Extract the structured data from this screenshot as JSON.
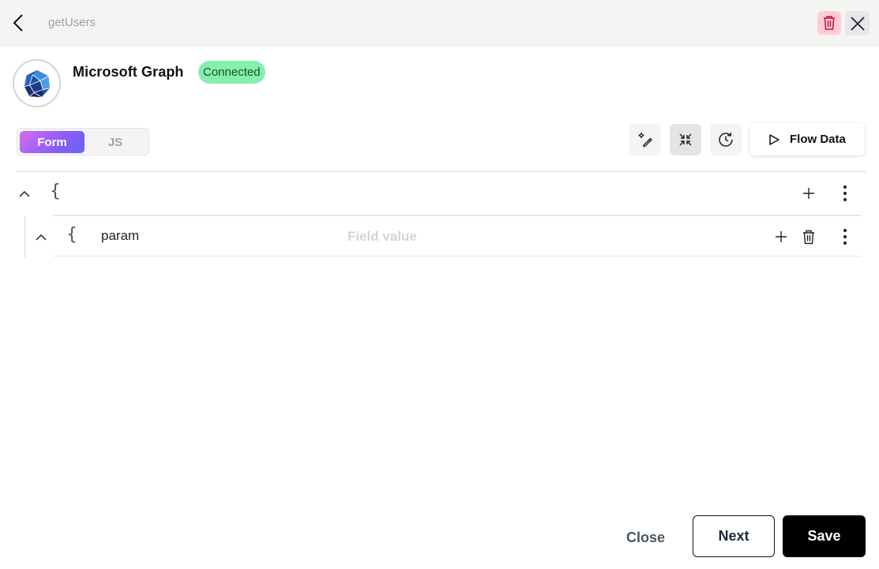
{
  "header": {
    "breadcrumb": "getUsers",
    "back_icon": "chevron-left-icon",
    "delete_icon": "trash-icon",
    "close_icon": "close-icon"
  },
  "connector": {
    "name": "Microsoft Graph",
    "status": "Connected",
    "logo_icon": "microsoft-graph-logo"
  },
  "mode_tabs": [
    {
      "label": "Form",
      "active": true
    },
    {
      "label": "JS",
      "active": false
    }
  ],
  "toolbar": {
    "tools": [
      {
        "icon": "magic-wand-icon"
      },
      {
        "icon": "collapse-icon",
        "active": true
      },
      {
        "icon": "history-icon"
      }
    ],
    "flow_data_label": "Flow Data"
  },
  "tree": {
    "root": {
      "brace": "{"
    },
    "children": [
      {
        "brace": "{",
        "key": "param",
        "value": "",
        "placeholder": "Field value"
      }
    ]
  },
  "footer": {
    "close_label": "Close",
    "next_label": "Next",
    "save_label": "Save"
  },
  "colors": {
    "connected_badge": "#86efac",
    "delete_bg": "#fecdd3",
    "save_bg": "#000000"
  }
}
